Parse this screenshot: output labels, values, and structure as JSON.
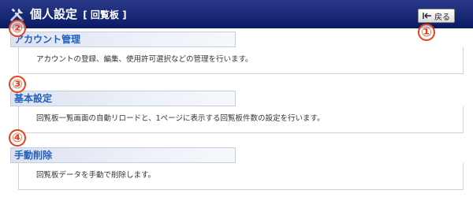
{
  "header": {
    "title": "個人設定",
    "subtitle": "[ 回覧板 ]",
    "back_label": "戻る",
    "background_color": "#0b1a64",
    "icon": "tools-icon"
  },
  "sections": [
    {
      "title": "アカウント管理",
      "description": "アカウントの登録、編集、使用許可選択などの管理を行います。"
    },
    {
      "title": "基本設定",
      "description": "回覧板一覧画面の自動リロードと、1ページに表示する回覧板件数の設定を行います。"
    },
    {
      "title": "手動削除",
      "description": "回覧板データを手動で削除します。"
    }
  ],
  "callouts": [
    "①",
    "②",
    "③",
    "④"
  ],
  "colors": {
    "accent": "#e3421d",
    "link": "#1f5fbf"
  }
}
